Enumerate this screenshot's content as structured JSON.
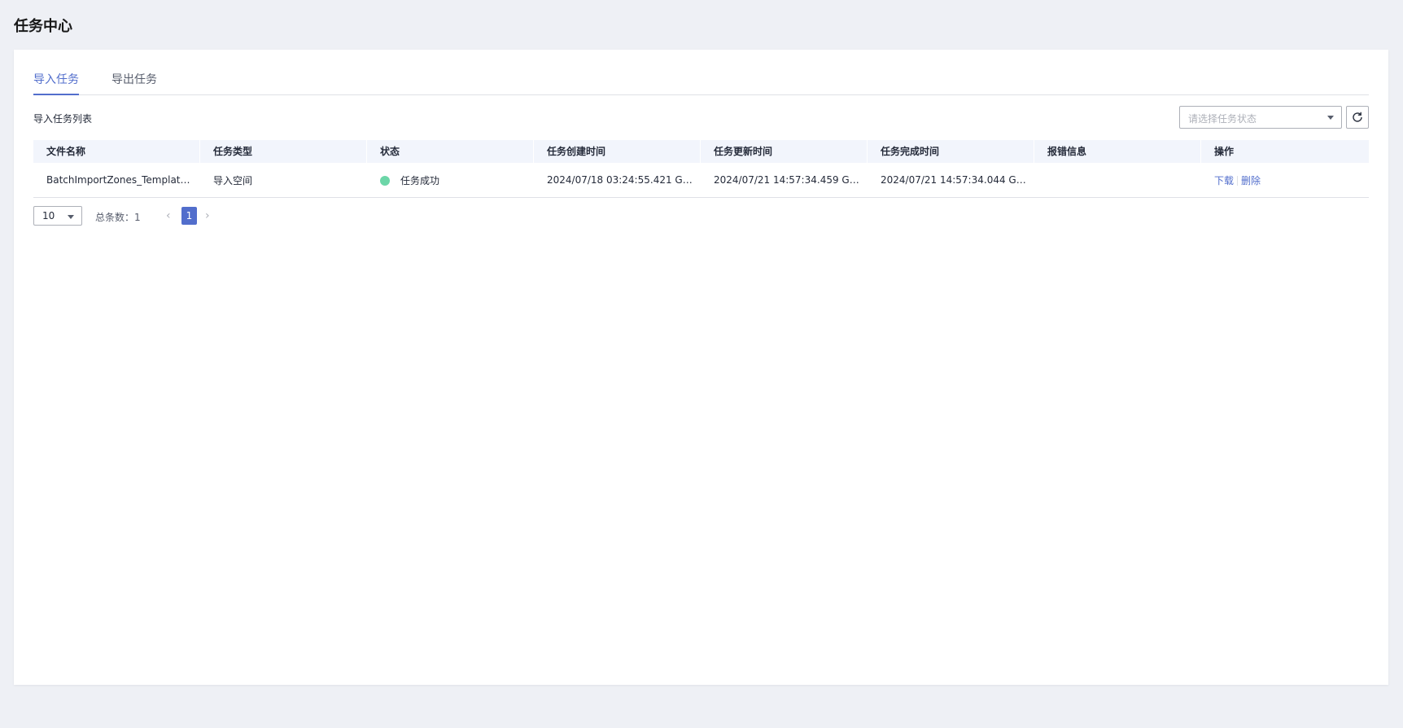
{
  "page": {
    "title": "任务中心"
  },
  "tabs": [
    {
      "label": "导入任务",
      "active": true
    },
    {
      "label": "导出任务",
      "active": false
    }
  ],
  "list": {
    "title": "导入任务列表",
    "status_filter_placeholder": "请选择任务状态",
    "refresh_icon": "refresh-icon"
  },
  "table": {
    "columns": [
      "文件名称",
      "任务类型",
      "状态",
      "任务创建时间",
      "任务更新时间",
      "任务完成时间",
      "报错信息",
      "操作"
    ],
    "rows": [
      {
        "file_name": "BatchImportZones_Template....",
        "task_type": "导入空间",
        "status": "任务成功",
        "status_color": "#6cd6a8",
        "created": "2024/07/18 03:24:55.421 GM...",
        "updated": "2024/07/21 14:57:34.459 GM...",
        "completed": "2024/07/21 14:57:34.044 GM...",
        "error": "",
        "actions": {
          "download": "下载",
          "delete": "删除"
        }
      }
    ]
  },
  "pagination": {
    "page_size": "10",
    "total_label": "总条数：1",
    "current_page": "1",
    "prev_icon": "chevron-left-icon",
    "next_icon": "chevron-right-icon"
  },
  "colors": {
    "accent": "#526ecc",
    "background": "#eef0f5",
    "success": "#6cd6a8"
  }
}
